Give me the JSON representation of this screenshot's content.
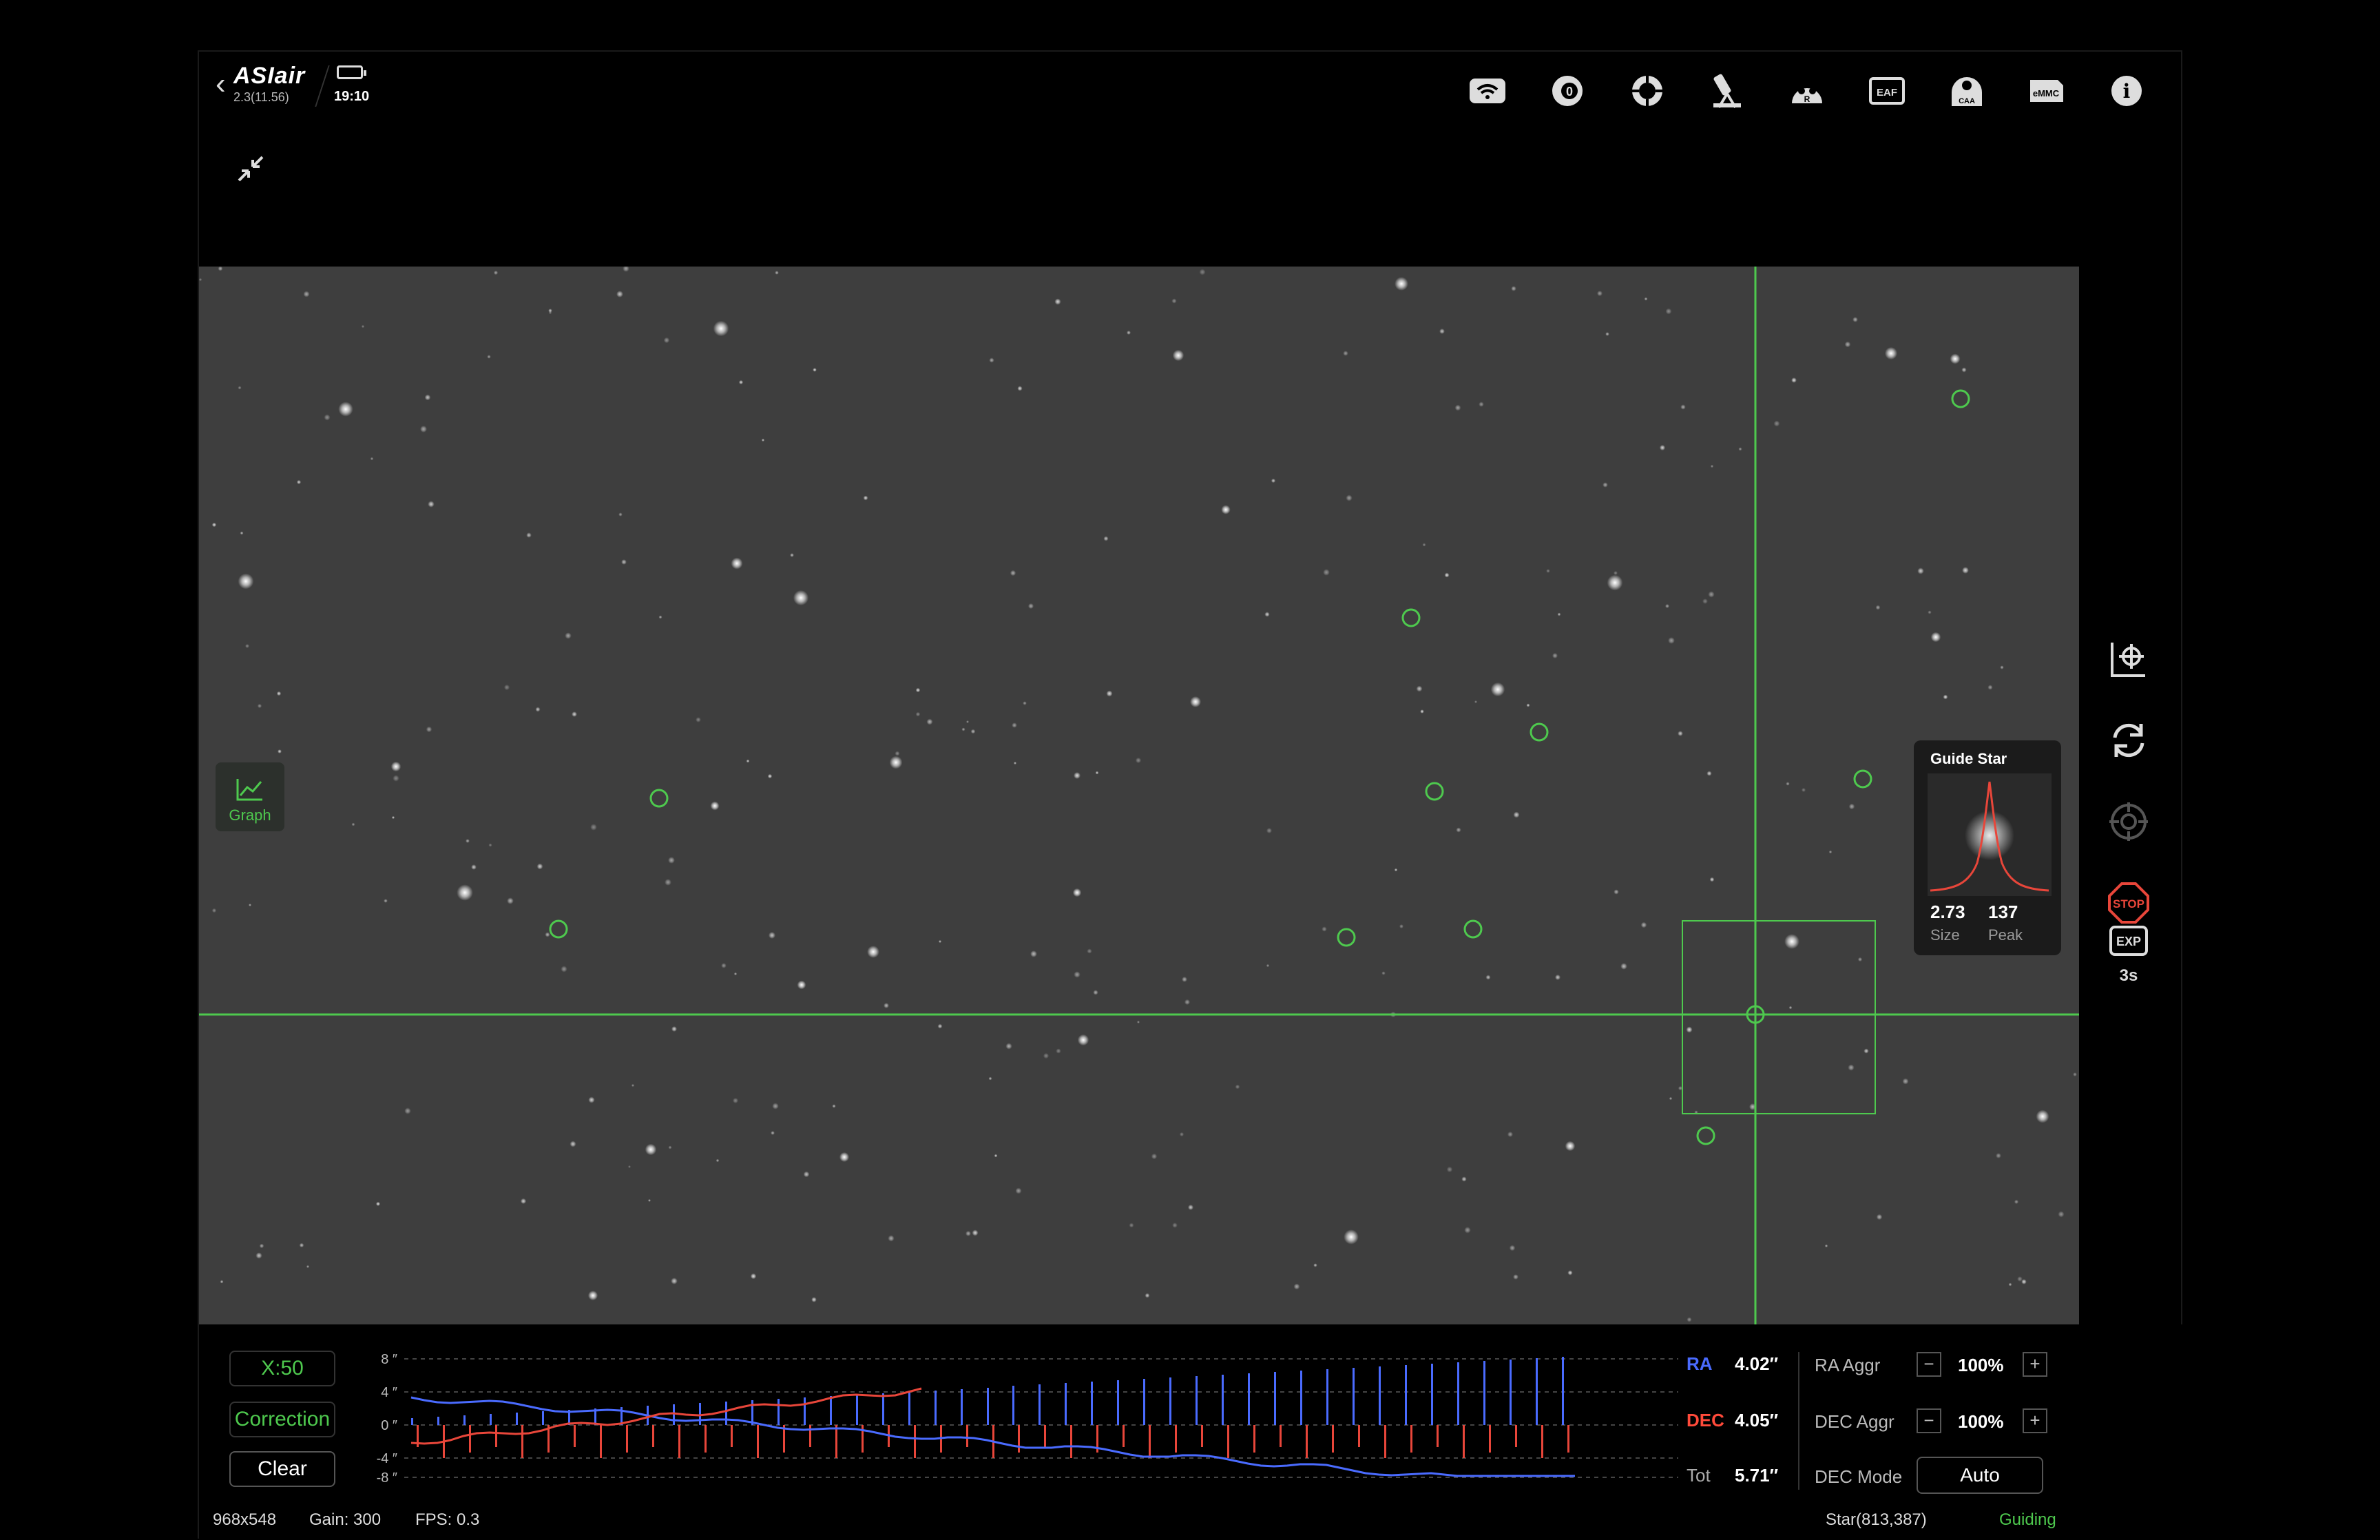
{
  "header": {
    "app_name": "ASIair",
    "version": "2.3(11.56)",
    "time": "19:10",
    "icons": [
      {
        "name": "wifi-icon",
        "label": ""
      },
      {
        "name": "camera-icon",
        "label": "0"
      },
      {
        "name": "focus-icon",
        "label": ""
      },
      {
        "name": "telescope-icon",
        "label": ""
      },
      {
        "name": "filter-wheel-icon",
        "label": "R"
      },
      {
        "name": "eaf-icon",
        "label": "EAF"
      },
      {
        "name": "caa-icon",
        "label": "CAA"
      },
      {
        "name": "emmc-icon",
        "label": "eMMC"
      },
      {
        "name": "info-icon",
        "label": "i"
      }
    ]
  },
  "viewer": {
    "graph_button_label": "Graph",
    "guide_star": {
      "title": "Guide Star",
      "size_value": "2.73",
      "size_label": "Size",
      "peak_value": "137",
      "peak_label": "Peak"
    }
  },
  "right_tools": {
    "exposure_badge": "EXP",
    "exposure_value": "3s",
    "stop_label": "STOP"
  },
  "bottom": {
    "buttons": {
      "scale": "X:50",
      "correction": "Correction",
      "clear": "Clear"
    },
    "y_ticks": [
      "8 ″",
      "4 ″",
      "0 ″",
      "-4 ″",
      "-8 ″"
    ],
    "ra_label": "RA",
    "ra_value": "4.02″",
    "dec_label": "DEC",
    "dec_value": "4.05″",
    "tot_label": "Tot",
    "tot_value": "5.71″",
    "ra_aggr_label": "RA Aggr",
    "ra_aggr_value": "100%",
    "dec_aggr_label": "DEC Aggr",
    "dec_aggr_value": "100%",
    "dec_mode_label": "DEC Mode",
    "dec_mode_value": "Auto",
    "minus": "−",
    "plus": "+"
  },
  "status_bar": {
    "resolution": "968x548",
    "gain": "Gain: 300",
    "fps": "FPS: 0.3",
    "star": "Star(813,387)",
    "state": "Guiding"
  },
  "colors": {
    "accent": "#4ec94e",
    "ra": "#4a6bff",
    "dec": "#ff4a3a",
    "crosshair": "#4ec94e"
  }
}
